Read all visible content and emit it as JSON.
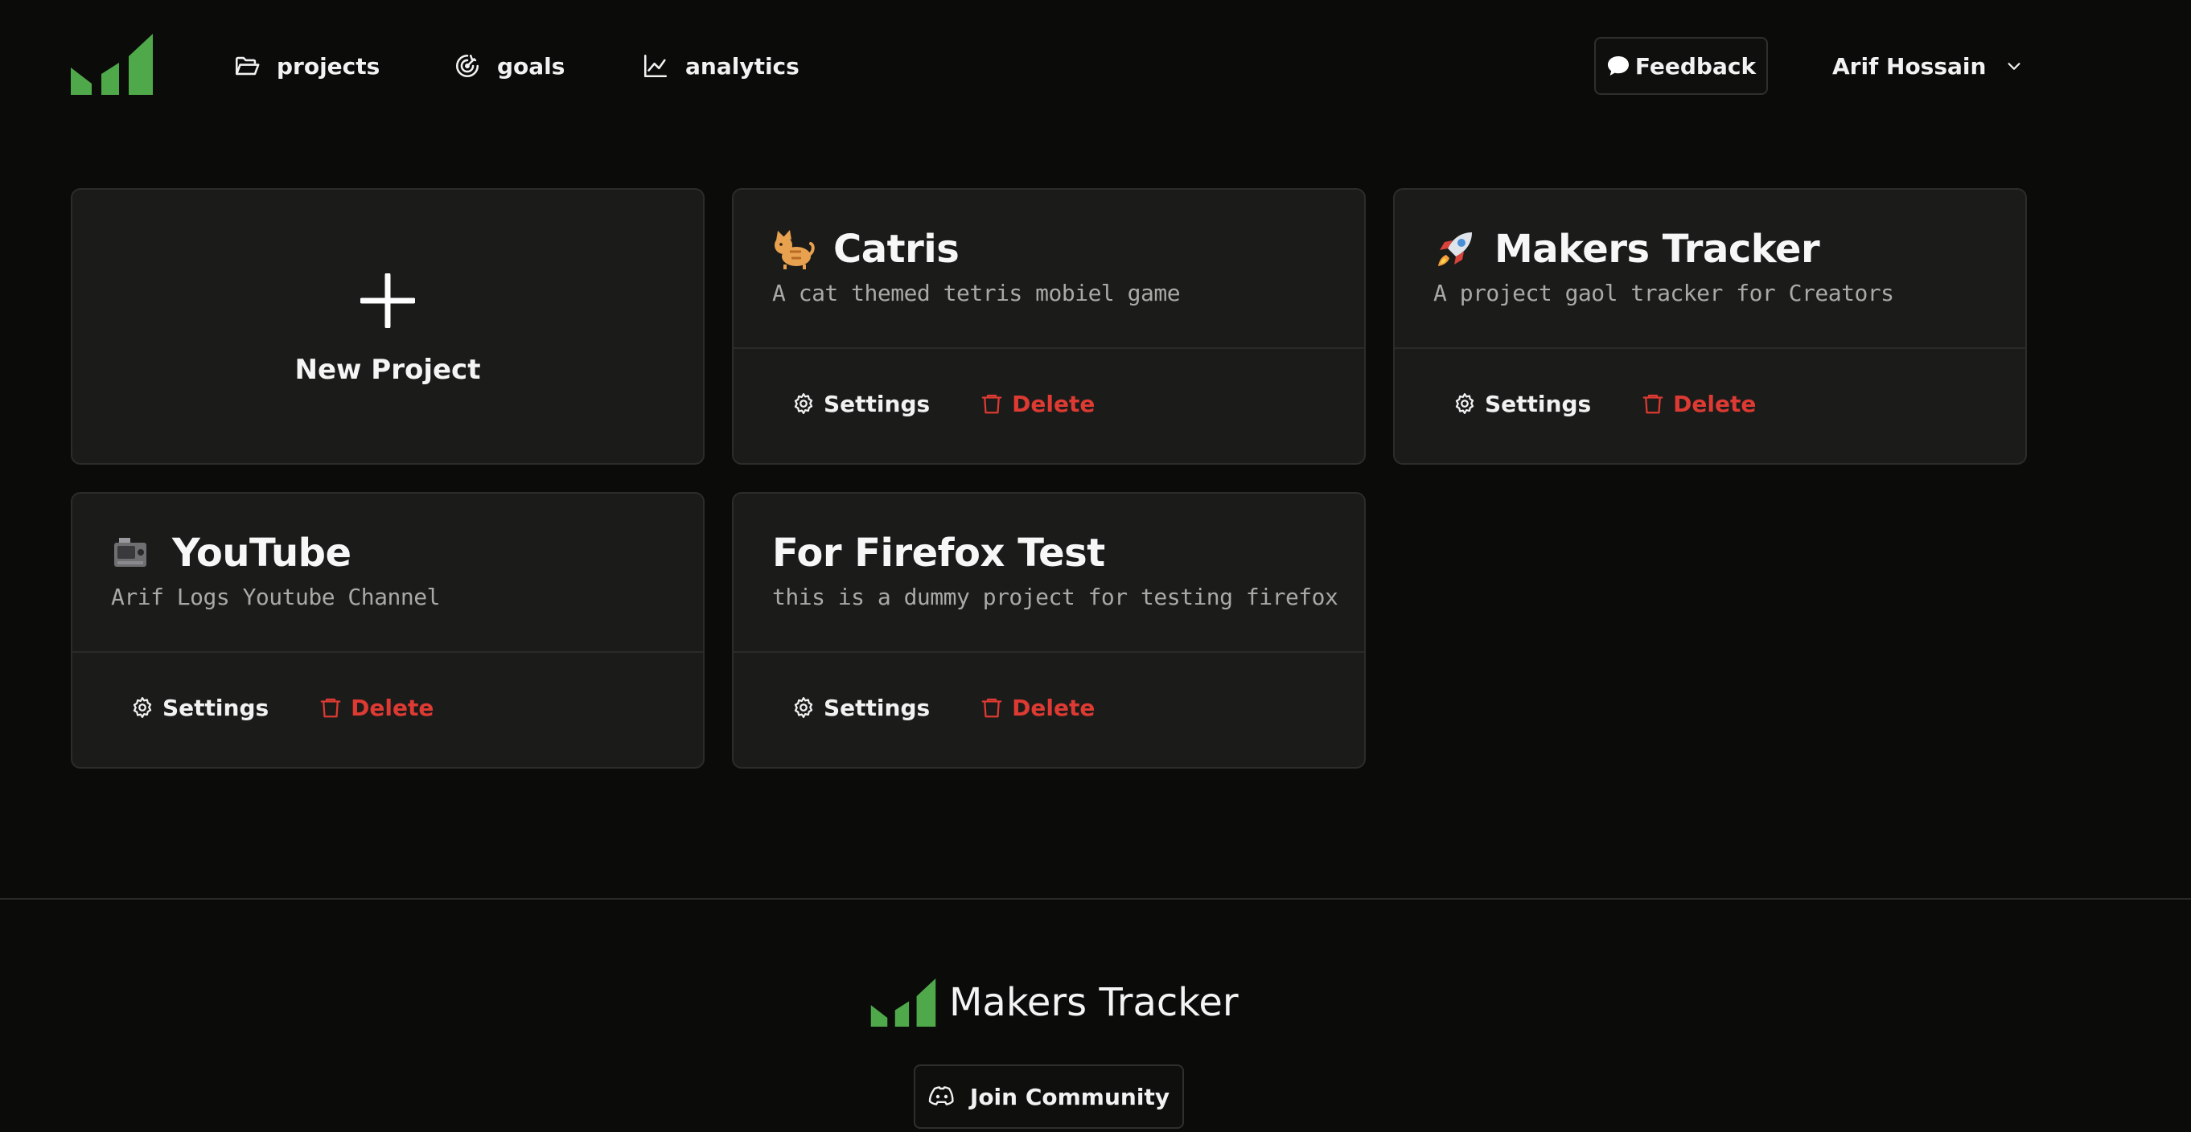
{
  "colors": {
    "brand_green": "#4fa94a",
    "background": "#0b0b0a",
    "card": "#1b1b1a",
    "danger": "#dc3a32"
  },
  "header": {
    "nav": [
      {
        "label": "projects",
        "icon": "folder-open-icon"
      },
      {
        "label": "goals",
        "icon": "goal-target-icon"
      },
      {
        "label": "analytics",
        "icon": "line-chart-icon"
      }
    ],
    "feedback_label": "Feedback",
    "user_name": "Arif Hossain"
  },
  "new_project": {
    "label": "New Project"
  },
  "projects": [
    {
      "emoji": "cat-emoji",
      "title": "Catris",
      "description": "A cat themed tetris mobiel game",
      "settings_label": "Settings",
      "delete_label": "Delete"
    },
    {
      "emoji": "rocket-emoji",
      "title": "Makers Tracker",
      "description": "A project gaol tracker for Creators",
      "settings_label": "Settings",
      "delete_label": "Delete"
    },
    {
      "emoji": "video-camera-emoji",
      "title": "YouTube",
      "description": "Arif Logs Youtube Channel",
      "settings_label": "Settings",
      "delete_label": "Delete"
    },
    {
      "emoji": "",
      "title": "For Firefox Test",
      "description": "this is a dummy project for testing firefox",
      "settings_label": "Settings",
      "delete_label": "Delete"
    }
  ],
  "footer": {
    "brand": "Makers Tracker",
    "community_label": "Join Community"
  }
}
